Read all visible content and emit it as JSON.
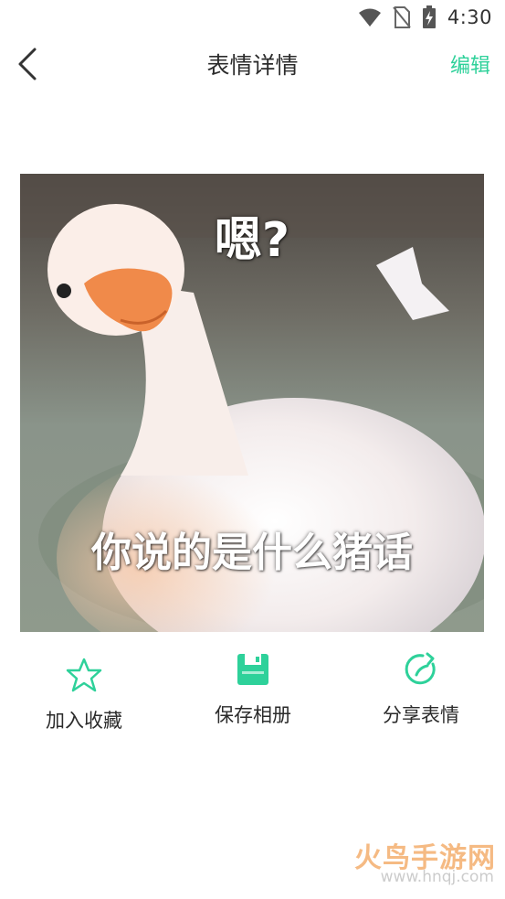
{
  "status_bar": {
    "time": "4:30",
    "icons": [
      "wifi-icon",
      "no-sim-icon",
      "battery-charging-icon"
    ]
  },
  "app_bar": {
    "back_icon": "chevron-left-icon",
    "title": "表情详情",
    "edit_label": "编辑"
  },
  "meme": {
    "caption_top": "嗯?",
    "caption_bottom": "你说的是什么猪话"
  },
  "actions": [
    {
      "label": "加入收藏",
      "icon": "star-icon"
    },
    {
      "label": "保存相册",
      "icon": "save-icon"
    },
    {
      "label": "分享表情",
      "icon": "share-icon"
    }
  ],
  "watermark": {
    "main": "火鸟手游网",
    "sub": "www.hnqj.com"
  },
  "colors": {
    "accent": "#2ed19a",
    "title_text": "#2b2b2b",
    "background": "#ffffff"
  }
}
